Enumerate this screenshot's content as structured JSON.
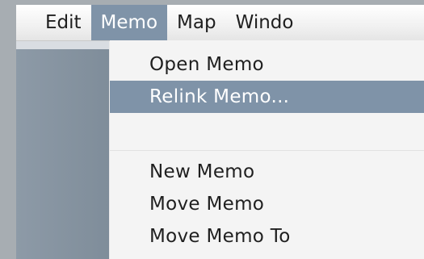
{
  "menubar": {
    "items": [
      {
        "label": "Edit"
      },
      {
        "label": "Memo"
      },
      {
        "label": "Map"
      },
      {
        "label": "Windo"
      }
    ],
    "active_item": "Memo"
  },
  "memo_menu": {
    "items": [
      {
        "label": "Open Memo"
      },
      {
        "label": "Relink Memo..."
      },
      {
        "label": "New Memo"
      },
      {
        "label": "Move Memo"
      },
      {
        "label": "Move Memo To"
      }
    ],
    "selected_item": "Relink Memo...",
    "colors": {
      "highlight": "#7f93a8",
      "menu_background": "#f4f4f4"
    }
  }
}
